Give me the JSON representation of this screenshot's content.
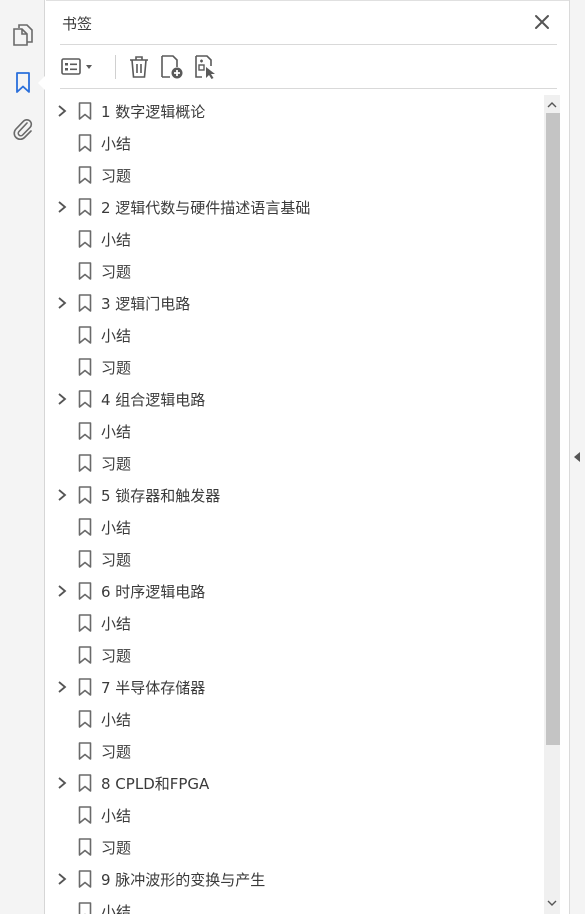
{
  "colors": {
    "accent": "#2a6fdb",
    "icon": "#6a6a6a",
    "text": "#3a3a3a",
    "scrollbar_thumb": "#c4c4c4"
  },
  "rail": {
    "items": [
      {
        "name": "pages",
        "icon": "pages-icon"
      },
      {
        "name": "bookmarks",
        "icon": "bookmark-icon",
        "active": true
      },
      {
        "name": "attachments",
        "icon": "paperclip-icon"
      }
    ]
  },
  "panel": {
    "title": "书签",
    "close_icon": "close-icon"
  },
  "toolbar": {
    "buttons": [
      "options-menu-icon",
      "delete-icon",
      "new-bookmark-icon",
      "new-bookmark-from-structure-icon"
    ]
  },
  "bookmarks": [
    {
      "label": "1 数字逻辑概论",
      "expandable": true
    },
    {
      "label": "小结",
      "expandable": false
    },
    {
      "label": "习题",
      "expandable": false
    },
    {
      "label": "2 逻辑代数与硬件描述语言基础",
      "expandable": true
    },
    {
      "label": "小结",
      "expandable": false
    },
    {
      "label": "习题",
      "expandable": false
    },
    {
      "label": "3 逻辑门电路",
      "expandable": true
    },
    {
      "label": "小结",
      "expandable": false
    },
    {
      "label": "习题",
      "expandable": false
    },
    {
      "label": "4 组合逻辑电路",
      "expandable": true
    },
    {
      "label": "小结",
      "expandable": false
    },
    {
      "label": "习题",
      "expandable": false
    },
    {
      "label": "5 锁存器和触发器",
      "expandable": true
    },
    {
      "label": "小结",
      "expandable": false
    },
    {
      "label": "习题",
      "expandable": false
    },
    {
      "label": "6 时序逻辑电路",
      "expandable": true
    },
    {
      "label": "小结",
      "expandable": false
    },
    {
      "label": "习题",
      "expandable": false
    },
    {
      "label": "7 半导体存储器",
      "expandable": true
    },
    {
      "label": "小结",
      "expandable": false
    },
    {
      "label": "习题",
      "expandable": false
    },
    {
      "label": "8 CPLD和FPGA",
      "expandable": true
    },
    {
      "label": "小结",
      "expandable": false
    },
    {
      "label": "习题",
      "expandable": false
    },
    {
      "label": "9 脉冲波形的变换与产生",
      "expandable": true
    },
    {
      "label": "小结",
      "expandable": false
    }
  ]
}
